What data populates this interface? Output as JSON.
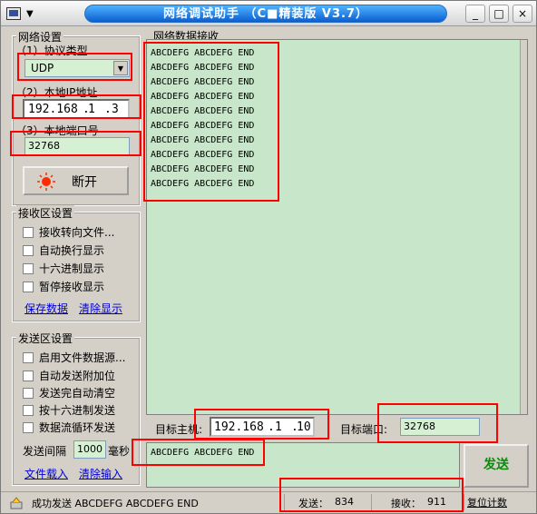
{
  "title": "网络调试助手 （C■精装版 V3.7）",
  "window_controls": {
    "minimize": "_",
    "maximize": "□",
    "close": "×"
  },
  "network_settings": {
    "title": "网络设置",
    "protocol_label": "（1）协议类型",
    "protocol_value": "UDP",
    "local_ip_label": "（2）本地IP地址",
    "local_ip": [
      "192.168",
      "1",
      "3"
    ],
    "local_port_label": "（3）本地端口号",
    "local_port": "32768",
    "disconnect_label": "断开"
  },
  "recv_settings": {
    "title": "接收区设置",
    "options": [
      "接收转向文件...",
      "自动换行显示",
      "十六进制显示",
      "暂停接收显示"
    ],
    "save_link": "保存数据",
    "clear_link": "清除显示"
  },
  "send_settings": {
    "title": "发送区设置",
    "options": [
      "启用文件数据源...",
      "自动发送附加位",
      "发送完自动清空",
      "按十六进制发送",
      "数据流循环发送"
    ],
    "interval_label": "发送间隔",
    "interval_value": "1000",
    "interval_unit": "毫秒",
    "load_file_link": "文件载入",
    "clear_input_link": "清除输入"
  },
  "recv_area": {
    "title": "网络数据接收",
    "lines": [
      "ABCDEFG ABCDEFG END",
      "ABCDEFG ABCDEFG END",
      "ABCDEFG ABCDEFG END",
      "ABCDEFG ABCDEFG END",
      "ABCDEFG ABCDEFG END",
      "ABCDEFG ABCDEFG END",
      "ABCDEFG ABCDEFG END",
      "ABCDEFG ABCDEFG END",
      "ABCDEFG ABCDEFG END",
      "ABCDEFG ABCDEFG END"
    ]
  },
  "target": {
    "host_label": "目标主机:",
    "host_ip": [
      "192.168",
      "1",
      "10"
    ],
    "port_label": "目标端口:",
    "port_value": "32768"
  },
  "send_area": {
    "text": "ABCDEFG ABCDEFG END",
    "send_button": "发送"
  },
  "status": {
    "message": "成功发送 ABCDEFG ABCDEFG END",
    "sent_label": "发送：",
    "sent_count": "834",
    "recv_label": "接收：",
    "recv_count": "911",
    "reset_label": "复位计数"
  },
  "colors": {
    "accent_red": "#ff0000",
    "area_green": "#c8e6c9",
    "send_green": "#0a8a0a"
  }
}
